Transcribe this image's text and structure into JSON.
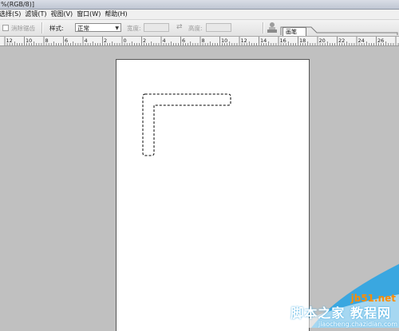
{
  "window": {
    "title_fragment": "%(RGB/8)]"
  },
  "menu": {
    "items": [
      {
        "label": "选择(S)"
      },
      {
        "label": "滤镜(T)"
      },
      {
        "label": "视图(V)"
      },
      {
        "label": "窗口(W)"
      },
      {
        "label": "帮助(H)"
      }
    ]
  },
  "options": {
    "antialias_label": "消除锯齿",
    "style_label": "样式:",
    "style_value": "正常",
    "width_label": "宽度:",
    "height_label": "高度:",
    "icons": {
      "swap": "swap-icon",
      "stamp": "stamp-icon",
      "dropdown": "chevron-down-icon"
    }
  },
  "palette_well": {
    "tab_label": "画笔"
  },
  "ruler": {
    "labels": [
      "12",
      "10",
      "8",
      "6",
      "4",
      "2",
      "0",
      "2",
      "4",
      "6",
      "8",
      "10",
      "12",
      "14",
      "16",
      "18",
      "20",
      "22",
      "24",
      "26"
    ]
  },
  "watermark": {
    "site": "jb51.net",
    "text": "脚本之家 教程网",
    "url": "jiaocheng.chazidian.com"
  },
  "colors": {
    "workspace": "#c0c0c0",
    "document": "#ffffff",
    "watermark_blue": "#3aa7e0",
    "watermark_orange": "#ff8c00"
  }
}
